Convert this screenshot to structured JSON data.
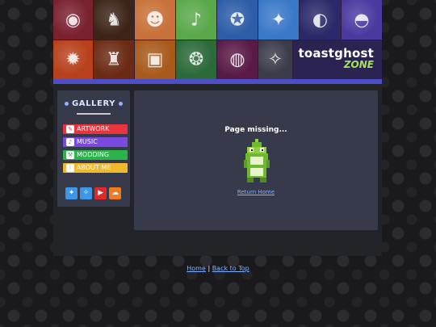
{
  "banner": {
    "brand_name": "toastghost",
    "brand_sub": "ZONE",
    "tiles": [
      {
        "icon": "robot-artwork-thumbnail",
        "glyph": "◉",
        "bg": "#7a2130"
      },
      {
        "icon": "adventurer-artwork-thumbnail",
        "glyph": "♞",
        "bg": "#3d2418"
      },
      {
        "icon": "strongman-artwork-thumbnail",
        "glyph": "☻",
        "bg": "#c8713a"
      },
      {
        "icon": "bird-artwork-thumbnail",
        "glyph": "♪",
        "bg": "#5aa84a"
      },
      {
        "icon": "knight-artwork-thumbnail",
        "glyph": "✪",
        "bg": "#2d5da8"
      },
      {
        "icon": "creature-artwork-thumbnail",
        "glyph": "✦",
        "bg": "#3a78c8"
      },
      {
        "icon": "astronaut-artwork-thumbnail",
        "glyph": "◐",
        "bg": "#2a2a6a"
      },
      {
        "icon": "crewmate-artwork-thumbnail",
        "glyph": "◓",
        "bg": "#4a3aa0"
      },
      {
        "icon": "demon-artwork-thumbnail",
        "glyph": "✹",
        "bg": "#b8401c"
      },
      {
        "icon": "boar-artwork-thumbnail",
        "glyph": "♜",
        "bg": "#6b2a14"
      },
      {
        "icon": "pixel-face-artwork-thumbnail",
        "glyph": "▣",
        "bg": "#a85a1c"
      },
      {
        "icon": "green-monster-artwork-thumbnail",
        "glyph": "❂",
        "bg": "#2c6a3a"
      },
      {
        "icon": "ufo-artwork-thumbnail",
        "glyph": "◍",
        "bg": "#5a1a48"
      },
      {
        "icon": "crowd-artwork-thumbnail",
        "glyph": "✧",
        "bg": "#3b3b4a"
      }
    ]
  },
  "sidebar": {
    "title": "GALLERY",
    "items": [
      {
        "label": "ARTWORK",
        "icon": "palette-icon",
        "glyph": "✎",
        "color": "#e8343c"
      },
      {
        "label": "MUSIC",
        "icon": "music-icon",
        "glyph": "♪",
        "color": "#7a4ae0"
      },
      {
        "label": "MODDING",
        "icon": "wrench-icon",
        "glyph": "⚒",
        "color": "#2cb34a"
      },
      {
        "label": "ABOUT ME",
        "icon": "info-icon",
        "glyph": "i",
        "color": "#f0b82c"
      }
    ],
    "social": [
      {
        "icon": "twitter-icon",
        "glyph": "✦",
        "color": "#3d97e8"
      },
      {
        "icon": "bluesky-icon",
        "glyph": "✧",
        "color": "#3d97e8"
      },
      {
        "icon": "youtube-icon",
        "glyph": "▶",
        "color": "#e02a2a"
      },
      {
        "icon": "soundcloud-icon",
        "glyph": "☁",
        "color": "#f07a1c"
      }
    ]
  },
  "content": {
    "heading": "Page missing...",
    "link": "Return Home"
  },
  "footer": {
    "home": "Home",
    "separator": "|",
    "top": "Back to Top"
  }
}
